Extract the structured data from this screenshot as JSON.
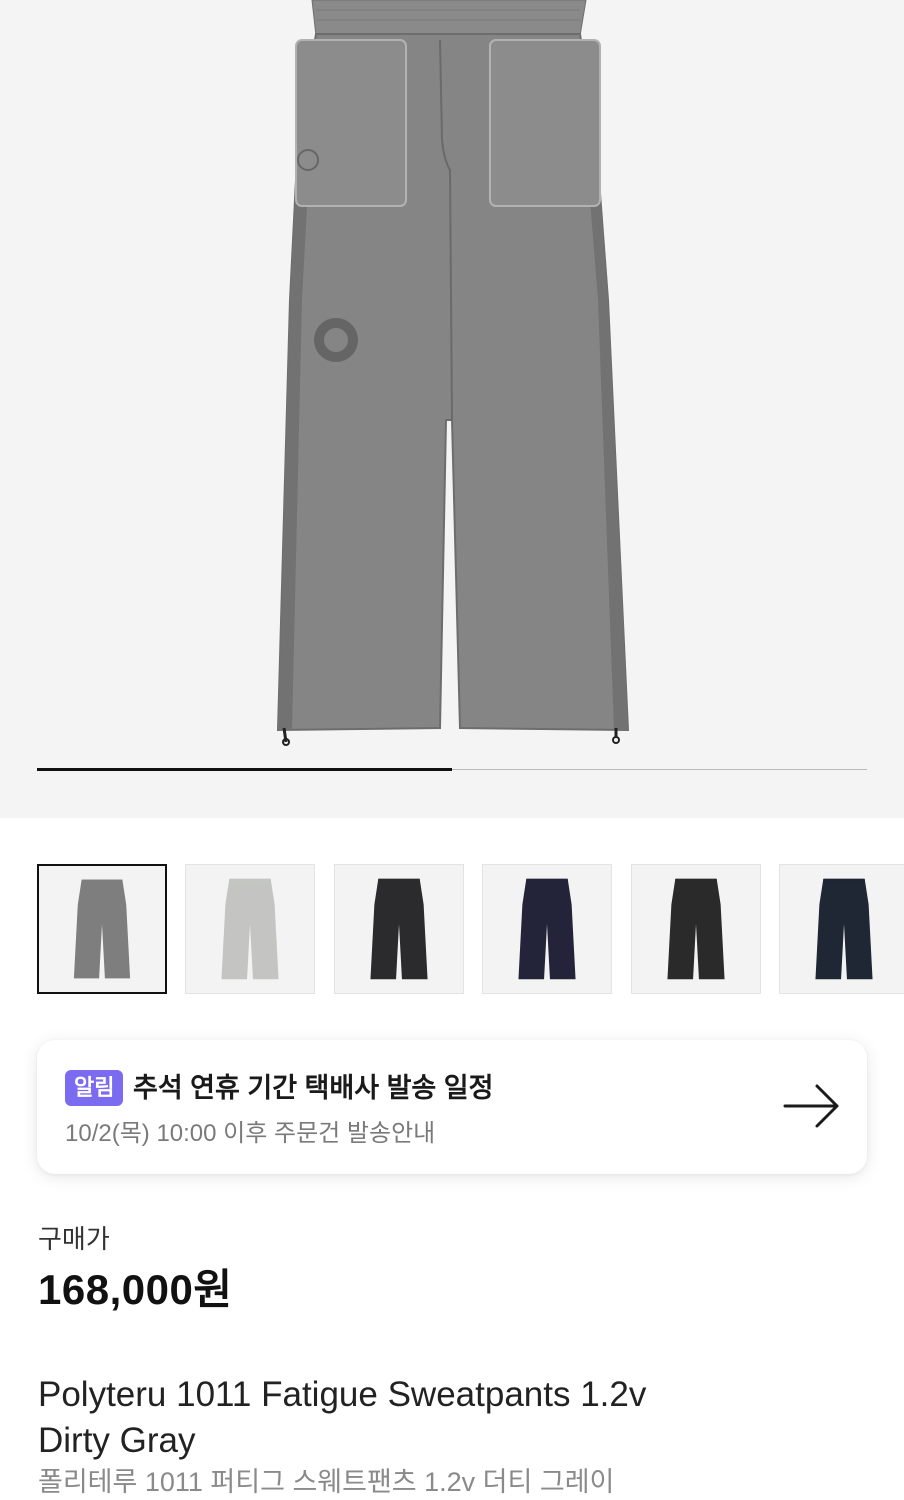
{
  "gallery": {
    "current_slide": 1,
    "slide_count": 2,
    "progress_fraction": 0.5
  },
  "thumbnails": [
    {
      "color": "#7e7e7e",
      "selected": true
    },
    {
      "color": "#c4c5c2",
      "selected": false
    },
    {
      "color": "#2b2b2d",
      "selected": false
    },
    {
      "color": "#23243a",
      "selected": false
    },
    {
      "color": "#2a2a2a",
      "selected": false
    },
    {
      "color": "#1f2735",
      "selected": false
    }
  ],
  "notice": {
    "badge": "알림",
    "title": "추석 연휴 기간 택배사 발송 일정",
    "subtitle": "10/2(목) 10:00 이후 주문건 발송안내",
    "icon": "arrow-right-icon"
  },
  "price": {
    "label": "구매가",
    "value": "168,000원"
  },
  "product": {
    "name_line1": "Polyteru 1011 Fatigue Sweatpants 1.2v",
    "name_line2": "Dirty Gray",
    "name_korean": "폴리테루 1011 퍼티그 스웨트팬츠 1.2v 더티 그레이"
  },
  "colors": {
    "badge": "#7b6bf0",
    "hero_background": "#f4f4f4",
    "pants_main": "#808080"
  }
}
